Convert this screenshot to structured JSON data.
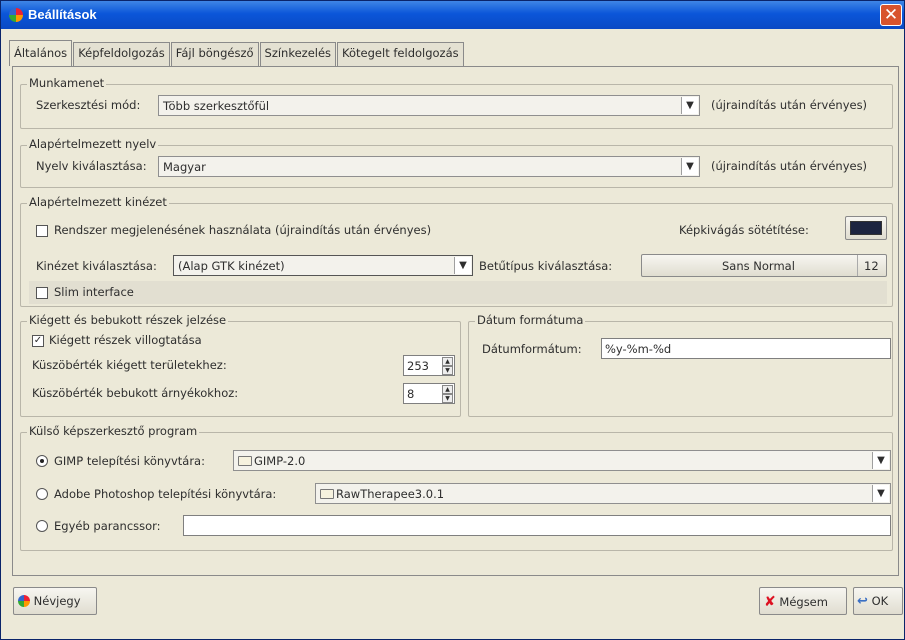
{
  "window": {
    "title": "Beállítások",
    "close_glyph": "✕"
  },
  "tabs": [
    "Általános",
    "Képfeldolgozás",
    "Fájl böngésző",
    "Színkezelés",
    "Kötegelt feldolgozás"
  ],
  "session": {
    "legend": "Munkamenet",
    "label": "Szerkesztési mód:",
    "value": "Több szerkesztőfül",
    "note": "(újraindítás után érvényes)"
  },
  "language": {
    "legend": "Alapértelmezett nyelv",
    "label": "Nyelv kiválasztása:",
    "value": "Magyar",
    "note": "(újraindítás után érvényes)"
  },
  "theme": {
    "legend": "Alapértelmezett kinézet",
    "system_checkbox_label": "Rendszer megjelenésének használata (újraindítás után érvényes)",
    "system_checked": false,
    "crop_darken_label": "Képkivágás sötétítése:",
    "crop_color": "#1c2440",
    "theme_label": "Kinézet kiválasztása:",
    "theme_value": "(Alap GTK kinézet)",
    "font_label": "Betűtípus kiválasztása:",
    "font_value": "Sans Normal",
    "font_size": "12",
    "slim_label": "Slim interface",
    "slim_checked": false
  },
  "clipping": {
    "legend": "Kiégett és bebukott részek jelzése",
    "blink_label": "Kiégett részek  villogtatása",
    "blink_checked": true,
    "highlight_label": "Küszöbérték kiégett területekhez:",
    "highlight_value": "253",
    "shadow_label": "Küszöbérték bebukott árnyékokhoz:",
    "shadow_value": "8"
  },
  "date": {
    "legend": "Dátum formátuma",
    "label": "Dátumformátum:",
    "value": "%y-%m-%d"
  },
  "editor": {
    "legend": "Külső képszerkesztő program",
    "gimp_label": "GIMP telepítési könyvtára:",
    "gimp_value": "GIMP-2.0",
    "photoshop_label": "Adobe Photoshop telepítési könyvtára:",
    "photoshop_value": "RawTherapee3.0.1",
    "custom_label": "Egyéb parancssor:",
    "custom_value": "",
    "selected": "gimp"
  },
  "footer": {
    "about_label": "Névjegy",
    "cancel_label": "Mégsem",
    "ok_label": "OK"
  }
}
